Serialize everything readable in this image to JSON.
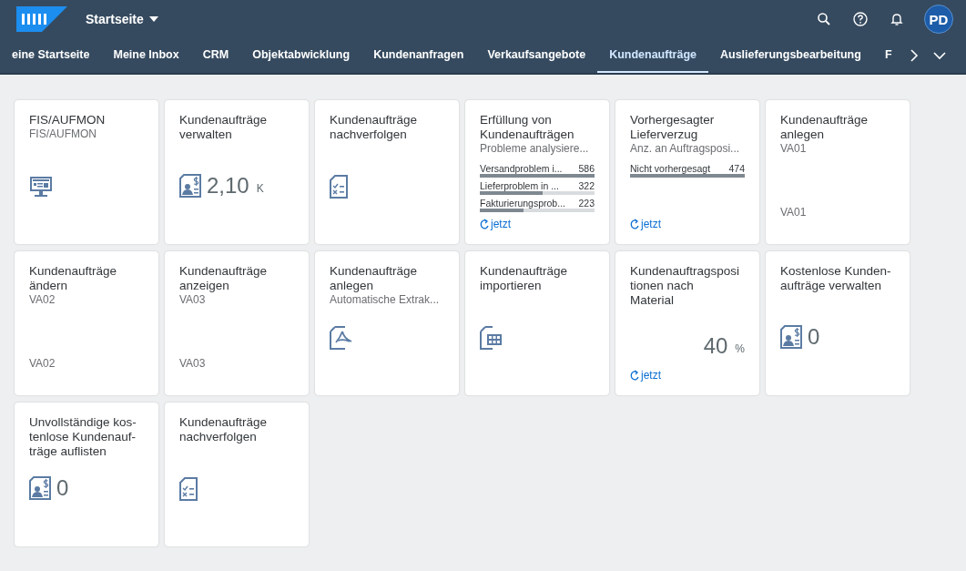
{
  "shell": {
    "title": "Startseite",
    "avatar": "PD"
  },
  "tabs": [
    {
      "label": "eine Startseite",
      "selected": false
    },
    {
      "label": "Meine Inbox",
      "selected": false
    },
    {
      "label": "CRM",
      "selected": false
    },
    {
      "label": "Objektabwicklung",
      "selected": false
    },
    {
      "label": "Kundenanfragen",
      "selected": false
    },
    {
      "label": "Verkaufsangebote",
      "selected": false
    },
    {
      "label": "Kundenaufträge",
      "selected": true
    },
    {
      "label": "Auslieferungsbearbeitung",
      "selected": false
    },
    {
      "label": "F",
      "selected": false
    }
  ],
  "tiles": [
    {
      "kind": "icon",
      "title": "FIS/AUFMON",
      "subtitle": "FIS/AUFMON"
    },
    {
      "kind": "numeric",
      "title": "Kundenaufträge\nverwalten",
      "value": "2,10",
      "unit": "K"
    },
    {
      "kind": "icon",
      "title": "Kundenaufträge\nnachverfolgen"
    },
    {
      "kind": "bars",
      "title": "Erfüllung von\nKundenaufträgen",
      "subtitle": "Probleme analysiere...",
      "bars": [
        {
          "label": "Versandproblem i...",
          "value": "586",
          "level": 1
        },
        {
          "label": "Lieferproblem in ...",
          "value": "322",
          "level": 0.55
        },
        {
          "label": "Fakturierungsprob...",
          "value": "223",
          "level": 0.38
        }
      ],
      "refresh": "jetzt"
    },
    {
      "kind": "bars",
      "title": "Vorhergesagter\nLieferverzug",
      "subtitle": "Anz. an Auftragsposi...",
      "bars": [
        {
          "label": "Nicht vorhergesagt",
          "value": "474",
          "level": 1
        }
      ],
      "refresh": "jetzt"
    },
    {
      "kind": "footer",
      "title": "Kundenaufträge\nanlegen",
      "subtitle": "VA01",
      "footer": "VA01"
    },
    {
      "kind": "footer",
      "title": "Kundenaufträge\nändern",
      "subtitle": "VA02",
      "footer": "VA02"
    },
    {
      "kind": "footer",
      "title": "Kundenaufträge\nanzeigen",
      "subtitle": "VA03",
      "footer": "VA03"
    },
    {
      "kind": "icon",
      "title": "Kundenaufträge\nanlegen",
      "subtitle": "Automatische Extrak..."
    },
    {
      "kind": "icon",
      "title": "Kundenaufträge\nimportieren"
    },
    {
      "kind": "numeric",
      "title": "Kundenauftragsposi\ntionen nach\nMaterial",
      "value": "40",
      "unit": "%",
      "refresh": "jetzt"
    },
    {
      "kind": "numeric",
      "title": "Kostenlose Kunden-\naufträge verwalten",
      "value": "0"
    },
    {
      "kind": "numeric",
      "title": "Unvollständige kos-\ntenlose Kundenauf-\nträge auflisten",
      "value": "0"
    },
    {
      "kind": "icon",
      "title": "Kundenaufträge\nnachverfolgen"
    }
  ]
}
